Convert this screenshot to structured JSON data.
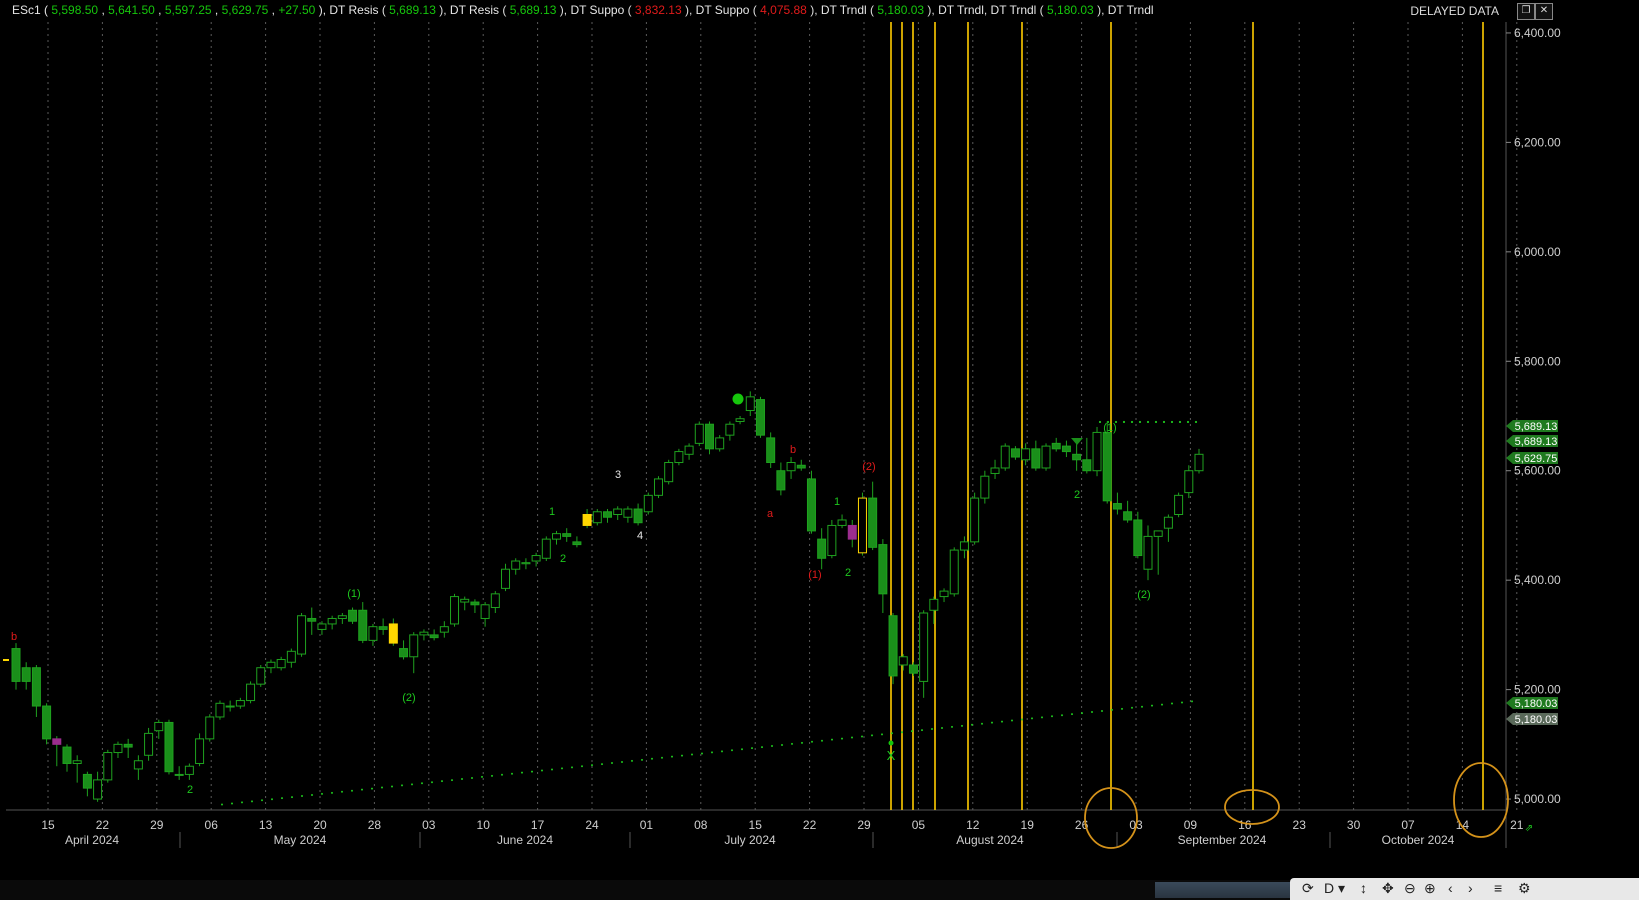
{
  "header": {
    "symbol": "ESc1",
    "quote": [
      "5,598.50",
      "5,641.50",
      "5,597.25",
      "5,629.75",
      "+27.50"
    ],
    "studies": [
      {
        "name": "DT Resis",
        "value": "5,689.13",
        "color": "#16c60c"
      },
      {
        "name": "DT Resis",
        "value": "5,689.13",
        "color": "#16c60c"
      },
      {
        "name": "DT Suppo",
        "value": "3,832.13",
        "color": "#e01b1b"
      },
      {
        "name": "DT Suppo",
        "value": "4,075.88",
        "color": "#e01b1b"
      },
      {
        "name": "DT Trndl",
        "value": "5,180.03",
        "color": "#16c60c"
      },
      {
        "name": "DT Trndl",
        "value": "",
        "color": ""
      },
      {
        "name": "DT Trndl",
        "value": "5,180.03",
        "color": "#16c60c"
      },
      {
        "name": "DT Trndl",
        "value": "",
        "color": ""
      }
    ],
    "delayed_label": "DELAYED DATA",
    "restore_icon": "restore-window-icon",
    "close_icon": "close-icon"
  },
  "colors": {
    "background": "#000000",
    "up_candle": "#000000",
    "up_outline": "#1fa21f",
    "down_candle": "#1a8f1a",
    "highlight_yellow": "#ffd700",
    "highlight_magenta": "#9b2d8e",
    "cycle_line": "#ffcc00",
    "dotted_green": "#1ec81e",
    "label_green": "#1ec81e",
    "label_red": "#e01b1b",
    "axis_text": "#cfcfcf",
    "circle": "#d4921a"
  },
  "chart_data": {
    "type": "candlestick",
    "y_axis": {
      "ticks": [
        "6,400.00",
        "6,200.00",
        "6,000.00",
        "5,800.00",
        "5,600.00",
        "5,400.00",
        "5,200.00",
        "5,000.00"
      ],
      "range": [
        4980,
        6420
      ]
    },
    "x_axis": {
      "day_ticks": [
        "15",
        "22",
        "29",
        "06",
        "13",
        "20",
        "28",
        "03",
        "10",
        "17",
        "24",
        "01",
        "08",
        "15",
        "22",
        "29",
        "05",
        "12",
        "19",
        "26",
        "03",
        "09",
        "16",
        "23",
        "30",
        "07",
        "14",
        "21"
      ],
      "month_labels": [
        "April 2024",
        "May 2024",
        "June 2024",
        "July 2024",
        "August 2024",
        "September 2024",
        "October 2024"
      ]
    },
    "price_labels": [
      {
        "text": "5,689.13",
        "value": 5689.13,
        "style": "green"
      },
      {
        "text": "5,689.13",
        "value": 5689.13,
        "style": "green"
      },
      {
        "text": "5,629.75",
        "value": 5629.75,
        "style": "green"
      },
      {
        "text": "5,180.03",
        "value": 5180.03,
        "style": "green"
      },
      {
        "text": "5,180.03",
        "value": 5180.03,
        "style": "gray"
      }
    ],
    "candles": [
      [
        5275,
        5285,
        5200,
        5215
      ],
      [
        5240,
        5250,
        5200,
        5215
      ],
      [
        5240,
        5245,
        5150,
        5170
      ],
      [
        5170,
        5175,
        5100,
        5110
      ],
      [
        5110,
        5115,
        5060,
        5100
      ],
      [
        5095,
        5100,
        5050,
        5065
      ],
      [
        5065,
        5080,
        5030,
        5070
      ],
      [
        5045,
        5050,
        5005,
        5020
      ],
      [
        5000,
        5050,
        4995,
        5035
      ],
      [
        5035,
        5090,
        5030,
        5085
      ],
      [
        5085,
        5105,
        5075,
        5100
      ],
      [
        5100,
        5110,
        5075,
        5095
      ],
      [
        5055,
        5080,
        5035,
        5070
      ],
      [
        5080,
        5130,
        5070,
        5120
      ],
      [
        5125,
        5145,
        5110,
        5140
      ],
      [
        5140,
        5145,
        5045,
        5050
      ],
      [
        5045,
        5060,
        5035,
        5045
      ],
      [
        5045,
        5065,
        5035,
        5060
      ],
      [
        5065,
        5120,
        5060,
        5110
      ],
      [
        5110,
        5155,
        5105,
        5150
      ],
      [
        5150,
        5180,
        5145,
        5175
      ],
      [
        5170,
        5180,
        5160,
        5170
      ],
      [
        5170,
        5185,
        5165,
        5180
      ],
      [
        5180,
        5215,
        5175,
        5210
      ],
      [
        5210,
        5245,
        5205,
        5240
      ],
      [
        5240,
        5255,
        5230,
        5250
      ],
      [
        5240,
        5260,
        5235,
        5255
      ],
      [
        5250,
        5275,
        5240,
        5270
      ],
      [
        5265,
        5340,
        5260,
        5335
      ],
      [
        5330,
        5350,
        5300,
        5325
      ],
      [
        5310,
        5325,
        5300,
        5320
      ],
      [
        5320,
        5335,
        5310,
        5330
      ],
      [
        5330,
        5340,
        5320,
        5335
      ],
      [
        5345,
        5350,
        5320,
        5325
      ],
      [
        5345,
        5360,
        5285,
        5290
      ],
      [
        5290,
        5320,
        5280,
        5315
      ],
      [
        5315,
        5330,
        5300,
        5310
      ],
      [
        5320,
        5330,
        5280,
        5285
      ],
      [
        5275,
        5290,
        5255,
        5260
      ],
      [
        5260,
        5305,
        5230,
        5300
      ],
      [
        5300,
        5310,
        5290,
        5305
      ],
      [
        5300,
        5310,
        5290,
        5295
      ],
      [
        5305,
        5325,
        5295,
        5315
      ],
      [
        5320,
        5375,
        5315,
        5370
      ],
      [
        5360,
        5370,
        5345,
        5365
      ],
      [
        5360,
        5365,
        5340,
        5355
      ],
      [
        5330,
        5360,
        5315,
        5355
      ],
      [
        5350,
        5380,
        5340,
        5375
      ],
      [
        5385,
        5430,
        5380,
        5420
      ],
      [
        5420,
        5440,
        5410,
        5435
      ],
      [
        5430,
        5440,
        5420,
        5432
      ],
      [
        5435,
        5450,
        5425,
        5445
      ],
      [
        5440,
        5480,
        5435,
        5475
      ],
      [
        5475,
        5490,
        5465,
        5485
      ],
      [
        5485,
        5495,
        5470,
        5480
      ],
      [
        5470,
        5480,
        5460,
        5465
      ],
      [
        5520,
        5530,
        5495,
        5500
      ],
      [
        5505,
        5530,
        5500,
        5525
      ],
      [
        5525,
        5530,
        5505,
        5515
      ],
      [
        5520,
        5535,
        5510,
        5530
      ],
      [
        5515,
        5535,
        5505,
        5530
      ],
      [
        5530,
        5540,
        5500,
        5505
      ],
      [
        5525,
        5560,
        5520,
        5555
      ],
      [
        5555,
        5590,
        5550,
        5585
      ],
      [
        5580,
        5620,
        5575,
        5615
      ],
      [
        5615,
        5640,
        5610,
        5635
      ],
      [
        5630,
        5650,
        5620,
        5645
      ],
      [
        5650,
        5690,
        5645,
        5685
      ],
      [
        5685,
        5690,
        5630,
        5640
      ],
      [
        5640,
        5665,
        5635,
        5660
      ],
      [
        5665,
        5690,
        5655,
        5685
      ],
      [
        5690,
        5700,
        5685,
        5695
      ],
      [
        5710,
        5745,
        5700,
        5735
      ],
      [
        5730,
        5735,
        5660,
        5665
      ],
      [
        5660,
        5670,
        5605,
        5615
      ],
      [
        5600,
        5615,
        5555,
        5565
      ],
      [
        5600,
        5625,
        5585,
        5615
      ],
      [
        5610,
        5620,
        5600,
        5605
      ],
      [
        5585,
        5600,
        5485,
        5490
      ],
      [
        5475,
        5495,
        5420,
        5440
      ],
      [
        5445,
        5510,
        5440,
        5500
      ],
      [
        5500,
        5520,
        5495,
        5510
      ],
      [
        5500,
        5510,
        5460,
        5475
      ],
      [
        5450,
        5560,
        5445,
        5550
      ],
      [
        5550,
        5580,
        5455,
        5460
      ],
      [
        5465,
        5475,
        5340,
        5375
      ],
      [
        5335,
        5340,
        5210,
        5225
      ],
      [
        5245,
        5265,
        5235,
        5260
      ],
      [
        5245,
        5250,
        5225,
        5230
      ],
      [
        5215,
        5345,
        5185,
        5340
      ],
      [
        5345,
        5370,
        5320,
        5365
      ],
      [
        5370,
        5385,
        5360,
        5380
      ],
      [
        5375,
        5460,
        5370,
        5455
      ],
      [
        5455,
        5480,
        5440,
        5470
      ],
      [
        5470,
        5560,
        5465,
        5550
      ],
      [
        5550,
        5600,
        5540,
        5590
      ],
      [
        5595,
        5620,
        5585,
        5605
      ],
      [
        5605,
        5650,
        5600,
        5645
      ],
      [
        5640,
        5645,
        5620,
        5625
      ],
      [
        5620,
        5650,
        5610,
        5640
      ],
      [
        5640,
        5655,
        5600,
        5605
      ],
      [
        5605,
        5650,
        5600,
        5645
      ],
      [
        5650,
        5660,
        5635,
        5640
      ],
      [
        5645,
        5655,
        5625,
        5635
      ],
      [
        5630,
        5650,
        5600,
        5620
      ],
      [
        5620,
        5660,
        5595,
        5600
      ],
      [
        5600,
        5680,
        5590,
        5670
      ],
      [
        5670,
        5690,
        5540,
        5545
      ],
      [
        5540,
        5560,
        5520,
        5530
      ],
      [
        5525,
        5545,
        5505,
        5510
      ],
      [
        5510,
        5525,
        5440,
        5445
      ],
      [
        5420,
        5500,
        5400,
        5480
      ],
      [
        5480,
        5490,
        5410,
        5490
      ],
      [
        5495,
        5520,
        5470,
        5515
      ],
      [
        5520,
        5560,
        5515,
        5555
      ],
      [
        5560,
        5610,
        5550,
        5600
      ],
      [
        5600,
        5640,
        5595,
        5630
      ]
    ],
    "annotations": [
      {
        "text": "b",
        "color": "red"
      },
      {
        "text": "(1)",
        "color": "green"
      },
      {
        "text": "(2)",
        "color": "green"
      },
      {
        "text": "1",
        "color": "green"
      },
      {
        "text": "2",
        "color": "green"
      },
      {
        "text": "2",
        "color": "green"
      },
      {
        "text": "3",
        "color": "white"
      },
      {
        "text": "4",
        "color": "white"
      },
      {
        "text": "b",
        "color": "red"
      },
      {
        "text": "a",
        "color": "red"
      },
      {
        "text": "(1)",
        "color": "red"
      },
      {
        "text": "(2)",
        "color": "red"
      },
      {
        "text": "2",
        "color": "green"
      },
      {
        "text": "1",
        "color": "green"
      },
      {
        "text": "2",
        "color": "green"
      },
      {
        "text": "(1)",
        "color": "green"
      },
      {
        "text": "(2)",
        "color": "green"
      },
      {
        "text": "X",
        "color": "green"
      }
    ],
    "resistance_level": 5689.13,
    "trendline": {
      "start": 4990,
      "end": 5180.03
    },
    "grid": "vertical dotted"
  },
  "toolbar": {
    "icons": [
      "refresh-icon",
      "d-dropdown-icon",
      "crosshair-icon",
      "pan-icon",
      "zoom-out-icon",
      "zoom-in-icon",
      "prev-icon",
      "next-icon",
      "menu-icon",
      "settings-icon"
    ],
    "labels": [
      "⟳",
      "D ▾",
      "↕",
      "✥",
      "⊖",
      "⊕",
      "‹",
      "›",
      "≡",
      "⚙"
    ]
  },
  "corner_label": "⇗"
}
